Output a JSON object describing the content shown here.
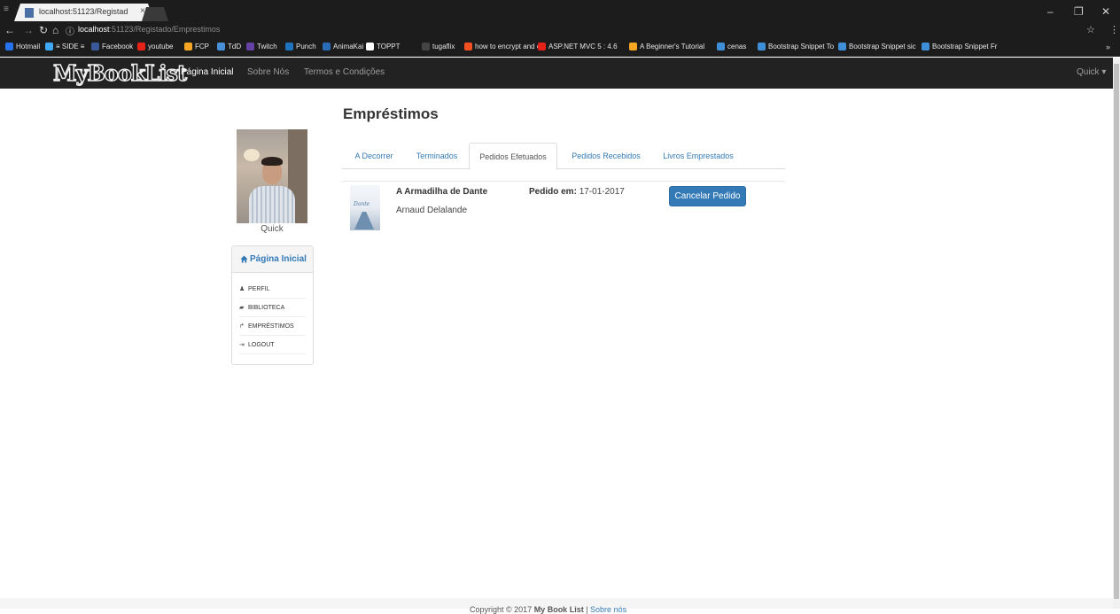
{
  "browser": {
    "tab_title": "localhost:51123/Registad ×",
    "tab_label": "localhost:51123/Registad",
    "tab_close": "×",
    "url_host": "localhost",
    "url_path": ":51123/Registado/Emprestimos",
    "window_controls": {
      "minimize": "–",
      "maximize": "❐",
      "close": "✕"
    },
    "bookmarks": [
      {
        "label": "Hotmail",
        "color": "#2672ec"
      },
      {
        "label": "≡ SIDE ≡",
        "color": "#3fa9f5"
      },
      {
        "label": "Facebook",
        "color": "#3b5998"
      },
      {
        "label": "youtube",
        "color": "#e62117"
      },
      {
        "label": "FCP",
        "color": "#f5a623"
      },
      {
        "label": "TdD",
        "color": "#4a90d9"
      },
      {
        "label": "Twitch",
        "color": "#6441a4"
      },
      {
        "label": "Punch",
        "color": "#1e73be"
      },
      {
        "label": "AnimaKai",
        "color": "#2a6bb5"
      },
      {
        "label": "TOPPT",
        "color": "#ffffff"
      },
      {
        "label": "tugaflix",
        "color": "#444444"
      },
      {
        "label": "how to encrypt and c",
        "color": "#f25022"
      },
      {
        "label": "ASP.NET MVC 5 : 4.6",
        "color": "#e62117"
      },
      {
        "label": "A Beginner's Tutorial",
        "color": "#f5a623"
      },
      {
        "label": "cenas",
        "color": "#3f8fd8"
      },
      {
        "label": "Bootstrap Snippet To",
        "color": "#3f8fd8"
      },
      {
        "label": "Bootstrap Snippet sic",
        "color": "#3f8fd8"
      },
      {
        "label": "Bootstrap Snippet Fr",
        "color": "#3f8fd8"
      }
    ],
    "bookmarks_more": "»"
  },
  "navbar": {
    "brand": "MyBookList",
    "links": [
      "Página Inicial",
      "Sobre Nós",
      "Termos e Condições"
    ],
    "active_link": "Página Inicial",
    "user_menu": "Quick ▾"
  },
  "sidebar": {
    "username": "Quick",
    "panel_title": "Página Inicial",
    "menu": [
      {
        "label": "PERFIL",
        "icon": "user-icon"
      },
      {
        "label": "BIBLIOTECA",
        "icon": "book-icon"
      },
      {
        "label": "EMPRÉSTIMOS",
        "icon": "share-icon"
      },
      {
        "label": "LOGOUT",
        "icon": "logout-icon"
      }
    ]
  },
  "main": {
    "title": "Empréstimos",
    "tabs": [
      "A Decorrer",
      "Terminados",
      "Pedidos Efetuados",
      "Pedidos Recebidos",
      "Livros Emprestados"
    ],
    "active_tab": "Pedidos Efetuados",
    "requests": [
      {
        "book_title": "A Armadilha de Dante",
        "cover_title": "Dante",
        "author": "Arnaud Delalande",
        "date_label": "Pedido em:",
        "date": "17-01-2017",
        "action": "Cancelar Pedido"
      }
    ]
  },
  "footer": {
    "text": "Copyright © 2017 ",
    "brand": "My Book List",
    "separator": " | ",
    "link": "Sobre nós"
  },
  "colors": {
    "accent": "#337ab7",
    "navbar": "#222222"
  }
}
